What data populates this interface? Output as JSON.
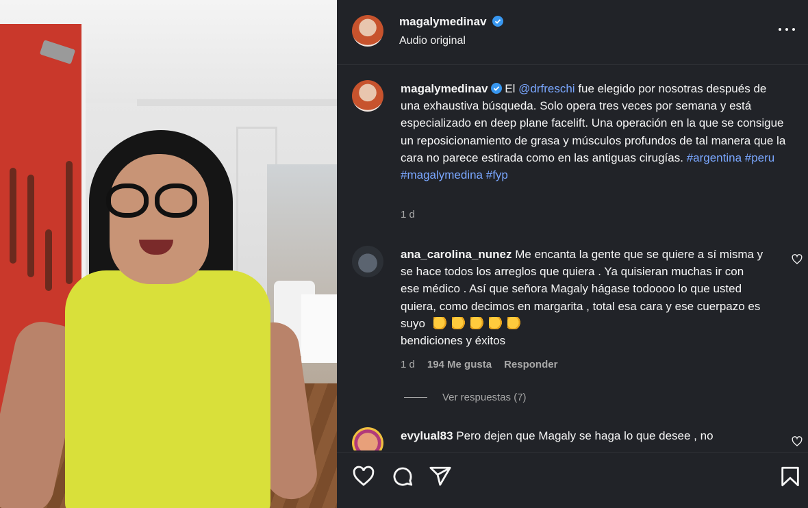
{
  "post": {
    "username": "magalymedinav",
    "audio": "Audio original",
    "caption": {
      "username": "magalymedinav",
      "text_before": "El ",
      "mention": "@drfreschi",
      "text_after": " fue elegido por nosotras después de una exhaustiva búsqueda. Solo opera tres veces por semana y está especializado en deep plane facelift. Una operación en la que se consigue un reposicionamiento de grasa y músculos profundos de tal manera que la cara no parece estirada como en las antiguas cirugías. ",
      "hashtags": [
        "#argentina",
        "#peru",
        "#magalymedina",
        "#fyp"
      ],
      "time": "1 d"
    }
  },
  "comments": [
    {
      "username": "ana_carolina_nunez",
      "text": "Me encanta la gente que se quiere a sí misma y se hace todos los arreglos que quiera . Ya quisieran muchas ir con ese médico . Así que señora Magaly hágase todoooo lo que usted quiera, como decimos en margarita , total esa cara y ese cuerpazo es suyo",
      "emoji_count": 5,
      "text_end": "bendiciones y éxitos",
      "time": "1 d",
      "likes": "194 Me gusta",
      "reply": "Responder",
      "view_replies": "Ver respuestas (7)"
    },
    {
      "username": "evylual83",
      "text": "Pero dejen que Magaly se haga lo que desee , no"
    }
  ],
  "icons": {
    "more": "more-options-icon",
    "like": "heart-icon",
    "comment": "comment-icon",
    "share": "share-icon",
    "save": "bookmark-icon",
    "verified": "verified-badge-icon"
  },
  "colors": {
    "panel_bg": "#212328",
    "link": "#7aa7ff",
    "verified": "#3897f0",
    "meta": "#a8a8a8"
  }
}
